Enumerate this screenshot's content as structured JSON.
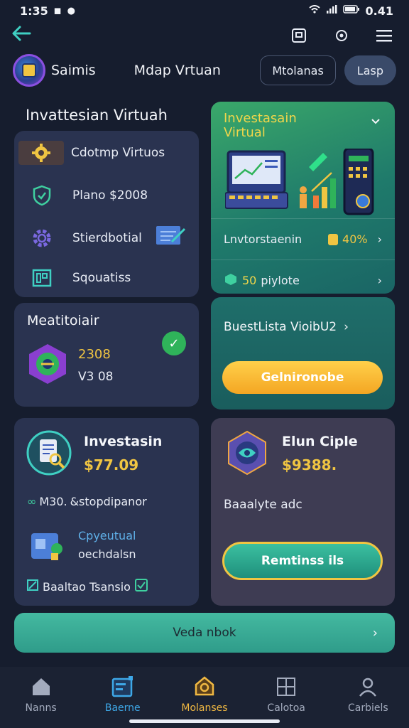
{
  "status_bar": {
    "time": "1:35",
    "battery": "0.41"
  },
  "header": {
    "brand": "Saimis",
    "title": "Mdap Vrtuan",
    "outline_button": "Mtolanas",
    "fill_button": "Lasp"
  },
  "section": {
    "title": "Invattesian Virtuah"
  },
  "left_menu": {
    "items": [
      {
        "label": "Cdotmp Virtuos",
        "icon": "gear-icon"
      },
      {
        "label": "Plano $2008",
        "icon": "shield-check-icon"
      },
      {
        "label": "Stierdbotial",
        "icon": "cog-icon"
      },
      {
        "label": "Sqouatiss",
        "icon": "calculator-icon"
      }
    ]
  },
  "green_card": {
    "title_line1": "Investasain",
    "title_line2": "Virtual",
    "row1_label": "Lnvtorstaenin",
    "row1_value": "40%",
    "row2_value": "50",
    "row2_label": "piylote"
  },
  "mid_left": {
    "title": "Meatitoiair",
    "value1": "2308",
    "value2": "V3 08"
  },
  "mid_right": {
    "title": "BuestLista VioibU2",
    "button": "Gelnironobe"
  },
  "bottom_left": {
    "title": "Investasin",
    "amount": "$77.09",
    "row_label": "M30.",
    "row_text": "&stopdipanor",
    "sub_line1": "Cpyeutual",
    "sub_line2": "oechdalsn",
    "footer": "Baaltao Tsansio"
  },
  "bottom_right": {
    "title": "Elun Ciple",
    "amount": "$9388.",
    "text": "Baaalyte adc",
    "button": "Remtinss ils"
  },
  "wide_button": {
    "label": "Veda nbok"
  },
  "bottom_nav": [
    {
      "label": "Nanns",
      "icon": "home-icon",
      "color": "#a3abbd"
    },
    {
      "label": "Baerne",
      "icon": "wallet-icon",
      "color": "#3ea8e8"
    },
    {
      "label": "Molanses",
      "icon": "bell-icon",
      "color": "#f0b842"
    },
    {
      "label": "Calotoa",
      "icon": "document-icon",
      "color": "#a3abbd"
    },
    {
      "label": "Carbiels",
      "icon": "user-icon",
      "color": "#a3abbd"
    }
  ],
  "colors": {
    "accent_teal": "#3fd0c3",
    "accent_orange": "#f4a623",
    "accent_yellow": "#f0c542",
    "card_bg": "#2a3350"
  }
}
